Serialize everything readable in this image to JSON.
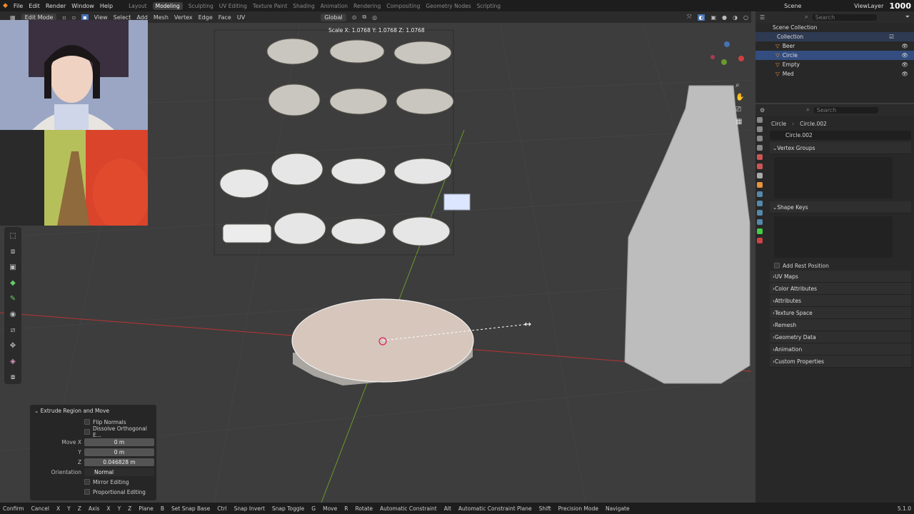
{
  "topbar": {
    "menus": [
      "File",
      "Edit",
      "Render",
      "Window",
      "Help"
    ],
    "workspaces": [
      "Layout",
      "Modeling",
      "Sculpting",
      "UV Editing",
      "Texture Paint",
      "Shading",
      "Animation",
      "Rendering",
      "Compositing",
      "Geometry Nodes",
      "Scripting"
    ],
    "active_workspace": "Modeling",
    "scene": "Scene",
    "view_layer": "ViewLayer",
    "corner_value": "1000"
  },
  "header": {
    "mode": "Edit Mode",
    "menus": [
      "View",
      "Select",
      "Add",
      "Mesh",
      "Vertex",
      "Edge",
      "Face",
      "UV"
    ],
    "transform_orientation": "Global"
  },
  "viewport": {
    "scale_readout": "Scale X: 1.0768   Y: 1.0768   Z: 1.0768"
  },
  "operator_panel": {
    "title": "Extrude Region and Move",
    "flip_normals": "Flip Normals",
    "dissolve": "Dissolve Orthogonal E...",
    "move_x_label": "Move X",
    "move_x": "0 m",
    "y_label": "Y",
    "move_y": "0 m",
    "z_label": "Z",
    "move_z": "0.046828 m",
    "orientation_label": "Orientation",
    "orientation": "Normal",
    "mirror": "Mirror Editing",
    "proportional": "Proportional Editing"
  },
  "outliner": {
    "search_placeholder": "Search",
    "scene_collection": "Scene Collection",
    "collection": "Collection",
    "items": [
      "Beer",
      "Circle",
      "Empty",
      "Med"
    ],
    "selected": "Circle"
  },
  "properties": {
    "search_placeholder": "Search",
    "object": "Circle",
    "mesh": "Circle.002",
    "datablock": "Circle.002",
    "vertex_groups": "Vertex Groups",
    "shape_keys": "Shape Keys",
    "add_rest_position": "Add Rest Position",
    "sections": [
      "UV Maps",
      "Color Attributes",
      "Attributes",
      "Texture Space",
      "Remesh",
      "Geometry Data",
      "Animation",
      "Custom Properties"
    ]
  },
  "statusbar": {
    "items": [
      "Confirm",
      "Cancel",
      "Axis",
      "Plane",
      "Set Snap Base",
      "Snap Invert",
      "Snap Toggle",
      "Move",
      "Rotate",
      "Automatic Constraint",
      "Automatic Constraint Plane",
      "Precision Mode",
      "Navigate"
    ],
    "keys": [
      "X",
      "Y",
      "Z",
      "X",
      "Y",
      "Z",
      "B",
      "Ctrl",
      "G",
      "R",
      "Alt",
      "Shift"
    ],
    "version": "5.1.0"
  },
  "colors": {
    "accent": "#4772b3",
    "selected_row": "#334d80",
    "x_axis": "#b83434",
    "y_axis": "#6a9a2a"
  }
}
